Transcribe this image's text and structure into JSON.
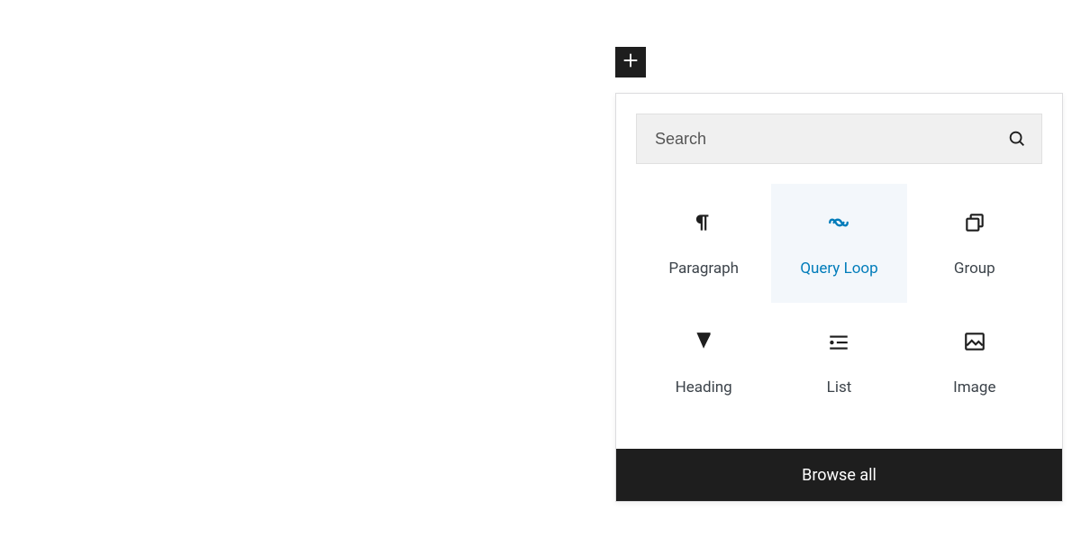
{
  "search": {
    "placeholder": "Search"
  },
  "blocks": [
    {
      "label": "Paragraph"
    },
    {
      "label": "Query Loop"
    },
    {
      "label": "Group"
    },
    {
      "label": "Heading"
    },
    {
      "label": "List"
    },
    {
      "label": "Image"
    }
  ],
  "footer": {
    "browse_all": "Browse all"
  }
}
